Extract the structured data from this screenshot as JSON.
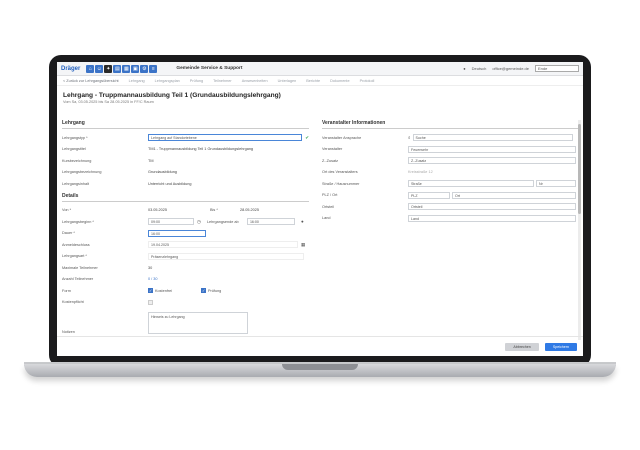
{
  "topbar": {
    "logo": "Dräger",
    "app_title": "Gemeinde Service & Support",
    "user": "Deutsch",
    "user_email": "office@gemeinde.de",
    "language": "Ende"
  },
  "navbar": {
    "back": "< Zurück zur Lehrgangsübersicht",
    "items": [
      "Lehrgang",
      "Lehrgangsplan",
      "Prüfung",
      "Teilnehmer",
      "Anwesenheiten",
      "Unterlagen",
      "Berichte",
      "Dokumente",
      "Protokoll"
    ]
  },
  "page": {
    "title": "Lehrgang - Truppmannausbildung Teil 1 (Grundausbildungslehrgang)",
    "subtitle": "Vom Sa, 03.05.2025 bis Sa 28.05.2025 in FF/C Raum"
  },
  "lehrgang": {
    "heading": "Lehrgang",
    "rows": [
      {
        "label": "Lehrgangstyp *",
        "value": "Lehrgang auf Standortebene"
      },
      {
        "label": "Lehrgangstitel",
        "value": "TM1 - Truppmannausbildung Teil 1 Grundausbildungslehrgang"
      },
      {
        "label": "Kursbezeichnung",
        "value": "TM"
      },
      {
        "label": "Lehrgangsbezeichnung",
        "value": "Grundausbildung"
      },
      {
        "label": "Lehrgangsinhalt",
        "value": "Unterricht und Ausbildung"
      }
    ]
  },
  "details": {
    "heading": "Details",
    "von_label": "Von *",
    "von_value": "03.05.2025",
    "bis_label": "Bis *",
    "bis_value": "28.05.2025",
    "beginn_label": "Lehrgangsbeginn *",
    "beginn_value": "09:00",
    "ende_label": "Lehrgangsende ab",
    "ende_value": "16:00",
    "dauer_label": "Dauer *",
    "dauer_value": "16:00",
    "anmeldeschluss_label": "Anmeldeschluss",
    "anmeldeschluss_value": "19.04.2025",
    "lehrgangsart_label": "Lehrgangsart *",
    "lehrgangsart_value": "Präsenzlehrgang",
    "max_label": "Maximale Teilnehmer",
    "max_value": "30",
    "anzahl_label": "Anzahl Teilnehmer",
    "anzahl_value": "0 / 30",
    "form_label": "Form",
    "form_opt1": "Kostenfrei",
    "form_opt2": "Prüfung",
    "kostenpflicht_label": "Kostenpflicht",
    "notizen_label": "Notizen",
    "notizen_value": "Hinweis zu Lehrgang"
  },
  "veranstalter": {
    "heading": "Veranstalter Informationen",
    "rows": [
      {
        "label": "Veranstalter Ansprache",
        "value": "Suche"
      },
      {
        "label": "Veranstalter",
        "value": "Feuerwehr"
      },
      {
        "label": "Z.-Zusatz",
        "value": "Z.-Zusatz"
      },
      {
        "label": "Ort des Veranstalters",
        "value": "Kreisstraße 12"
      },
      {
        "label": "Straße / Hausnummer",
        "value": "Straße"
      },
      {
        "label": "PLZ / Ort",
        "value": "PLZ"
      },
      {
        "label": "Ortsteil",
        "value": "Ortsteil"
      },
      {
        "label": "Land",
        "value": "Land"
      }
    ],
    "hausnr": "Nr",
    "ort": "Ort"
  },
  "footer": {
    "cancel": "Abbrechen",
    "save": "Speichern"
  }
}
